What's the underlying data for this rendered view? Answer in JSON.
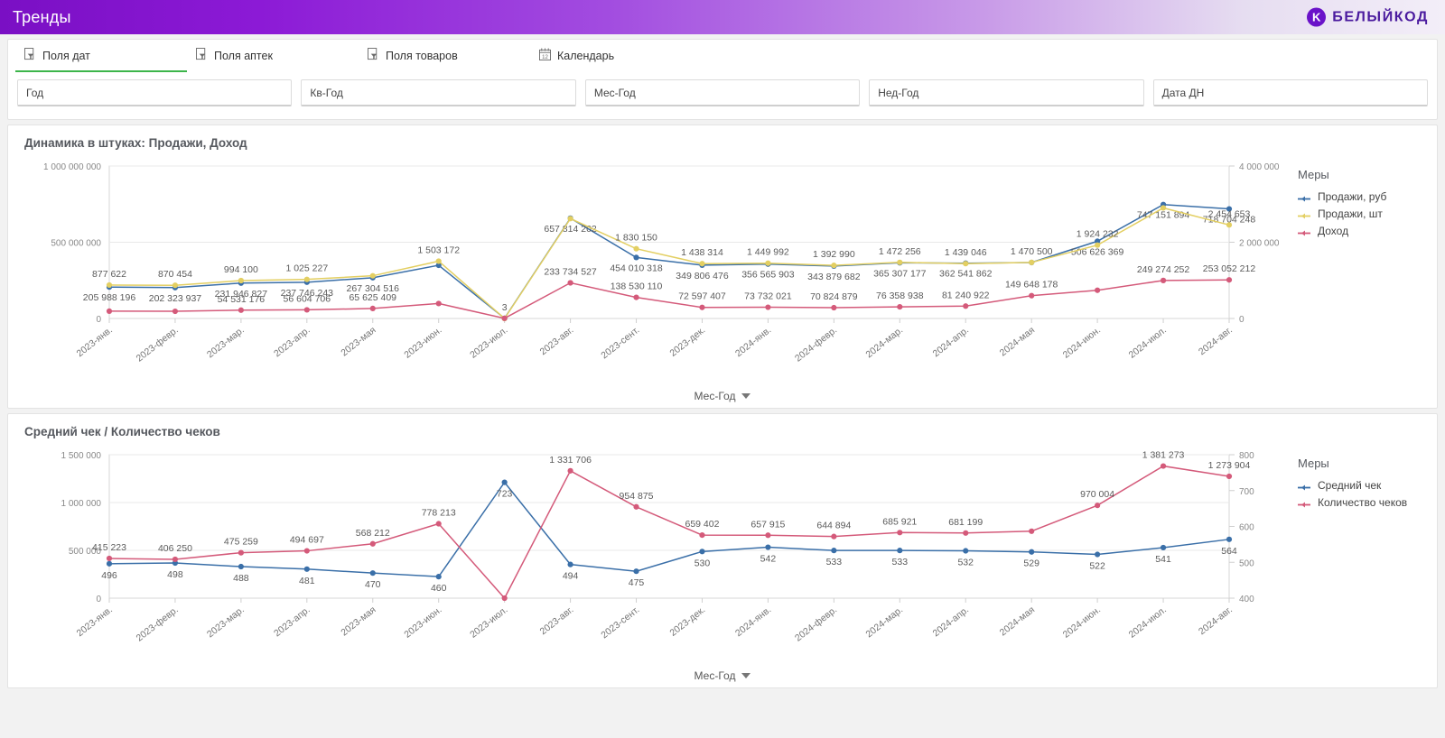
{
  "header": {
    "title": "Тренды",
    "brand_text": "БЕЛЫЙКОД",
    "brand_mark": "logo-icon",
    "accent_purple": "#7a0fc4",
    "brand_purple": "#4a1a9e"
  },
  "filters": {
    "tabs": [
      {
        "label": "Поля дат",
        "icon": "filter-field-icon",
        "active": true
      },
      {
        "label": "Поля аптек",
        "icon": "filter-field-icon",
        "active": false
      },
      {
        "label": "Поля товаров",
        "icon": "filter-field-icon",
        "active": false
      },
      {
        "label": "Календарь",
        "icon": "calendar-icon",
        "active": false
      }
    ],
    "active_underline_color": "#3cb54a",
    "fields": [
      {
        "placeholder": "Год",
        "value": "Год"
      },
      {
        "placeholder": "Кв-Год",
        "value": "Кв-Год"
      },
      {
        "placeholder": "Мес-Год",
        "value": "Мес-Год"
      },
      {
        "placeholder": "Нед-Год",
        "value": "Нед-Год"
      },
      {
        "placeholder": "Дата ДН",
        "value": "Дата ДН"
      }
    ]
  },
  "chart_data": [
    {
      "type": "line",
      "title": "Динамика в штуках: Продажи, Доход",
      "xlabel": "Мес-Год",
      "ylabel": "",
      "axis_selector": "Мес-Год",
      "legend_title": "Меры",
      "legend_position": "right",
      "grid": true,
      "ylim": [
        0,
        1000000000
      ],
      "yticks": [
        "0",
        "500 000 000",
        "1 000 000 000"
      ],
      "y2lim": [
        0,
        4000000
      ],
      "y2ticks": [
        "0",
        "2 000 000",
        "4 000 000"
      ],
      "categories": [
        "2023-янв.",
        "2023-февр.",
        "2023-мар.",
        "2023-апр.",
        "2023-мая",
        "2023-июн.",
        "2023-июл.",
        "2023-авг.",
        "2023-сент.",
        "2023-дек.",
        "2024-янв.",
        "2024-февр.",
        "2024-мар.",
        "2024-апр.",
        "2024-мая",
        "2024-июн.",
        "2024-июл.",
        "2024-авг."
      ],
      "series": [
        {
          "name": "Продажи, руб",
          "color": "#3a6fa8",
          "axis": "left",
          "values": [
            205988196,
            202323937,
            231946827,
            237746243,
            267304516,
            349000000,
            1000000,
            657814202,
            400000000,
            349806476,
            356565903,
            343879682,
            365307177,
            362541862,
            367000000,
            506626369,
            747151894,
            718704248
          ],
          "labels": [
            "205 988 196",
            "202 323 937",
            "231 946 827",
            "237 746 243",
            "267 304 516",
            "",
            "",
            "657 814 202",
            "454 010 318",
            "349 806 476",
            "356 565 903",
            "343 879 682",
            "365 307 177",
            "362 541 862",
            "",
            "506 626 369",
            "747 151 894",
            "718 704 248"
          ]
        },
        {
          "name": "Продажи, шт",
          "color": "#e3cf62",
          "axis": "right",
          "values": [
            877622,
            870454,
            994100,
            1025227,
            1120000,
            1503172,
            3,
            2620000,
            1830150,
            1438314,
            1449992,
            1392990,
            1472256,
            1439046,
            1470500,
            1924232,
            2900000,
            2454653
          ],
          "labels": [
            "877 622",
            "870 454",
            "994 100",
            "1 025 227",
            "",
            "1 503 172",
            "3",
            "",
            "1 830 150",
            "1 438 314",
            "1 449 992",
            "1 392 990",
            "1 472 256",
            "1 439 046",
            "1 470 500",
            "1 924 232",
            "",
            "2 454 653"
          ]
        },
        {
          "name": "Доход",
          "color": "#d45a7a",
          "axis": "left",
          "values": [
            48000000,
            47000000,
            54531176,
            56604706,
            65625409,
            98000000,
            1000000,
            233734527,
            138530110,
            72597407,
            73732021,
            70824879,
            76358938,
            81240922,
            149648178,
            185000000,
            249274252,
            253052212
          ],
          "labels": [
            "",
            "",
            "54 531 176",
            "56 604 706",
            "65 625 409",
            "",
            "",
            "233 734 527",
            "138 530 110",
            "72 597 407",
            "73 732 021",
            "70 824 879",
            "76 358 938",
            "81 240 922",
            "149 648 178",
            "",
            "249 274 252",
            "253 052 212"
          ]
        }
      ]
    },
    {
      "type": "line",
      "title": "Средний чек / Количество чеков",
      "xlabel": "Мес-Год",
      "ylabel": "",
      "axis_selector": "Мес-Год",
      "legend_title": "Меры",
      "legend_position": "right",
      "grid": true,
      "ylim": [
        0,
        1500000
      ],
      "yticks": [
        "0",
        "500 000",
        "1 000 000",
        "1 500 000"
      ],
      "y2lim": [
        400,
        800
      ],
      "y2ticks": [
        "400",
        "500",
        "600",
        "700",
        "800"
      ],
      "categories": [
        "2023-янв.",
        "2023-февр.",
        "2023-мар.",
        "2023-апр.",
        "2023-мая",
        "2023-июн.",
        "2023-июл.",
        "2023-авг.",
        "2023-сент.",
        "2023-дек.",
        "2024-янв.",
        "2024-февр.",
        "2024-мар.",
        "2024-апр.",
        "2024-мая",
        "2024-июн.",
        "2024-июл.",
        "2024-авг."
      ],
      "series": [
        {
          "name": "Средний чек",
          "color": "#3a6fa8",
          "axis": "right",
          "values": [
            496,
            498,
            488,
            481,
            470,
            460,
            723,
            494,
            475,
            530,
            542,
            533,
            533,
            532,
            529,
            522,
            541,
            564
          ],
          "labels": [
            "496",
            "498",
            "488",
            "481",
            "470",
            "460",
            "723",
            "494",
            "475",
            "530",
            "542",
            "533",
            "533",
            "532",
            "529",
            "522",
            "541",
            "564"
          ]
        },
        {
          "name": "Количество чеков",
          "color": "#d45a7a",
          "axis": "left",
          "values": [
            415223,
            406250,
            475259,
            494697,
            568212,
            778213,
            0,
            1331706,
            954875,
            659402,
            657915,
            644894,
            685921,
            681199,
            700000,
            970004,
            1381273,
            1273904
          ],
          "labels": [
            "415 223",
            "406 250",
            "475 259",
            "494 697",
            "568 212",
            "778 213",
            "",
            "1 331 706",
            "954 875",
            "659 402",
            "657 915",
            "644 894",
            "685 921",
            "681 199",
            "",
            "970 004",
            "1 381 273",
            "1 273 904"
          ]
        }
      ]
    }
  ]
}
